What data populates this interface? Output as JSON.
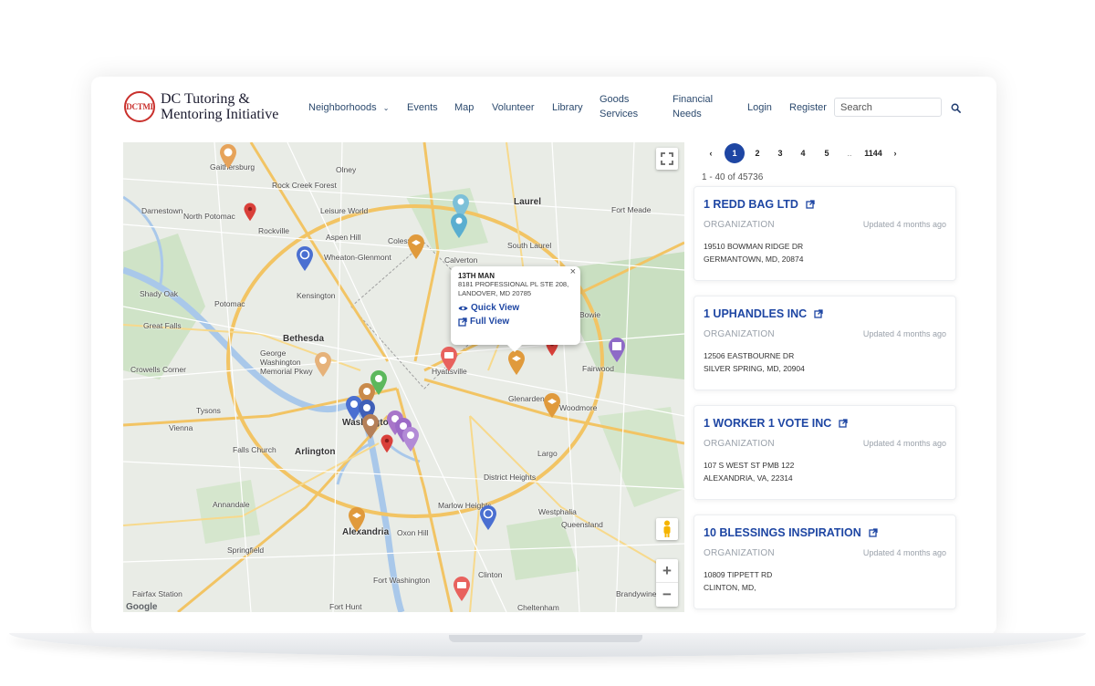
{
  "logo": {
    "badge_text": "DCTMI",
    "title": "DC Tutoring & Mentoring Initiative"
  },
  "nav": {
    "items": [
      {
        "label": "Neighborhoods",
        "has_dropdown": true
      },
      {
        "label": "Events"
      },
      {
        "label": "Map"
      },
      {
        "label": "Volunteer"
      },
      {
        "label": "Library"
      },
      {
        "label": "Goods Services"
      },
      {
        "label": "Financial Needs"
      },
      {
        "label": "Login"
      },
      {
        "label": "Register"
      }
    ]
  },
  "search": {
    "placeholder": "Search",
    "value": "",
    "icon": "search-icon"
  },
  "map": {
    "places": [
      "Gaithersburg",
      "Rockville",
      "North Potomac",
      "Darnestown",
      "Aspen Hill",
      "Colesville",
      "Calverton",
      "South Laurel",
      "Laurel",
      "Fort Meade",
      "Wheaton-Glenmont",
      "Kensington",
      "Potomac",
      "Great Falls",
      "Bethesda",
      "George Washington Memorial Pkwy",
      "Shady Oak",
      "Hyattsville",
      "Glenarden",
      "Bowie",
      "Fairwood",
      "Woodmore",
      "Tysons",
      "Vienna",
      "Falls Church",
      "Arlington",
      "Washington",
      "Largo",
      "District Heights",
      "Westphalia",
      "Marlow Heights",
      "Annandale",
      "Alexandria",
      "Springfield",
      "Oxon Hill",
      "Queensland",
      "Clinton",
      "Cheltenham",
      "Fort Washington",
      "Rock Creek Forest",
      "Olney",
      "Leisure World",
      "Crowells Corner",
      "Fairfax Station",
      "Fort Hunt",
      "Brandywine"
    ],
    "popup": {
      "title": "13TH MAN",
      "address_line1": "8181 PROFESSIONAL PL STE 208,",
      "address_line2": "LANDOVER, MD 20785",
      "quick_view": "Quick View",
      "full_view": "Full View",
      "close": "×"
    },
    "controls": {
      "zoom_in": "+",
      "zoom_out": "−",
      "fullscreen": "fullscreen-icon",
      "pegman": "pegman-icon"
    },
    "attribution": "Google"
  },
  "pagination": {
    "prev": "‹",
    "pages": [
      "1",
      "2",
      "3",
      "4",
      "5",
      "..",
      "1144"
    ],
    "next": "›",
    "active": "1"
  },
  "results": {
    "count_text": "1 - 40 of 45736",
    "items": [
      {
        "name": "1 REDD BAG LTD",
        "type": "ORGANIZATION",
        "updated": "Updated 4 months ago",
        "address1": "19510 BOWMAN RIDGE DR",
        "address2": "GERMANTOWN, MD, 20874"
      },
      {
        "name": "1 UPHANDLES INC",
        "type": "ORGANIZATION",
        "updated": "Updated 4 months ago",
        "address1": "12506 EASTBOURNE DR",
        "address2": "SILVER SPRING, MD, 20904"
      },
      {
        "name": "1 WORKER 1 VOTE INC",
        "type": "ORGANIZATION",
        "updated": "Updated 4 months ago",
        "address1": "107 S WEST ST PMB 122",
        "address2": "ALEXANDRIA, VA, 22314"
      },
      {
        "name": "10 BLESSINGS INSPIRATION",
        "type": "ORGANIZATION",
        "updated": "Updated 4 months ago",
        "address1": "10809 TIPPETT RD",
        "address2": "CLINTON, MD,"
      }
    ]
  },
  "colors": {
    "accent": "#1e46a3",
    "brand_red": "#c9302c",
    "pin_orange": "#e09a3c",
    "pin_blue": "#4a6fd1",
    "pin_purple": "#9c6bc7",
    "pin_red": "#e05a5a",
    "pin_teal": "#5aaed0",
    "pin_green": "#5cb85c"
  }
}
